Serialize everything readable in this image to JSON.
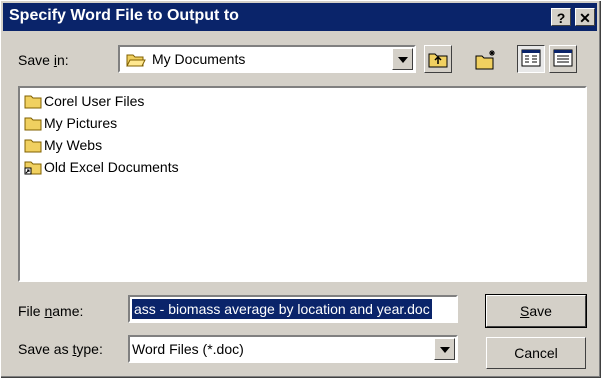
{
  "dialog": {
    "title": "Specify Word File to Output to",
    "help_label": "?",
    "close_label": "✕"
  },
  "save_in": {
    "label_pre": "Save ",
    "label_u": "i",
    "label_post": "n:",
    "value": "My Documents"
  },
  "toolbar": {
    "icons": [
      "up-one-level-icon",
      "create-new-folder-icon",
      "list-view-icon",
      "details-view-icon"
    ]
  },
  "files": [
    {
      "name": "Corel User Files",
      "icon": "folder-icon"
    },
    {
      "name": "My Pictures",
      "icon": "folder-icon"
    },
    {
      "name": "My Webs",
      "icon": "folder-icon"
    },
    {
      "name": "Old Excel Documents",
      "icon": "folder-shortcut-icon"
    }
  ],
  "file_name": {
    "label_pre": "File ",
    "label_u": "n",
    "label_post": "ame:",
    "value": "ass - biomass average by location and year.doc"
  },
  "save_as_type": {
    "label_pre": "Save as ",
    "label_u": "t",
    "label_post": "ype:",
    "value": "Word Files (*.doc)"
  },
  "buttons": {
    "save_u": "S",
    "save_rest": "ave",
    "cancel": "Cancel"
  }
}
